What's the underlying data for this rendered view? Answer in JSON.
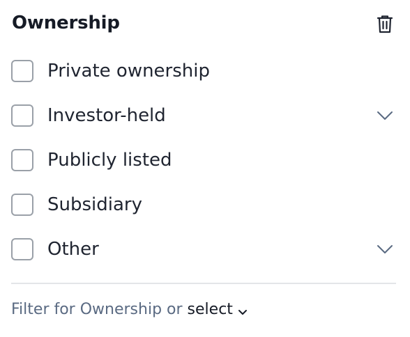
{
  "filter": {
    "title": "Ownership",
    "delete_icon": "trash-icon",
    "options": [
      {
        "label": "Private ownership",
        "checked": false,
        "expandable": false
      },
      {
        "label": "Investor-held",
        "checked": false,
        "expandable": true
      },
      {
        "label": "Publicly listed",
        "checked": false,
        "expandable": false
      },
      {
        "label": "Subsidiary",
        "checked": false,
        "expandable": false
      },
      {
        "label": "Other",
        "checked": false,
        "expandable": true
      }
    ],
    "footer": {
      "prefix": "Filter for Ownership or",
      "select_label": "select"
    }
  },
  "colors": {
    "text": "#1f2430",
    "muted": "#5a6a82",
    "checkbox_border": "#9aa0a8",
    "divider": "#e3e5e8"
  }
}
